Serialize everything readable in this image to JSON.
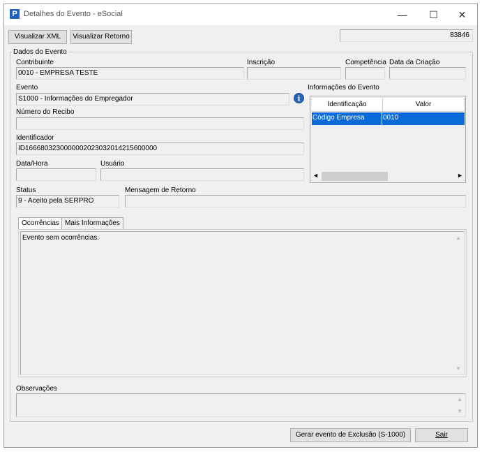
{
  "window": {
    "title": "Detalhes do Evento - eSocial",
    "app_icon": "P",
    "minimize": "—",
    "maximize": "☐",
    "close": "✕"
  },
  "toolbar": {
    "view_xml": "Visualizar XML",
    "view_return": "Visualizar Retorno",
    "id_value": "83846"
  },
  "group": {
    "title": "Dados do Evento",
    "contribuinte_label": "Contribuinte",
    "contribuinte_value": "0010 - EMPRESA TESTE",
    "inscricao_label": "Inscrição",
    "inscricao_value": "",
    "competencia_label": "Competência",
    "competencia_value": "",
    "data_criacao_label": "Data da Criação",
    "data_criacao_value": "",
    "evento_label": "Evento",
    "evento_value": "S1000 - Informações do Empregador",
    "info_icon": "i",
    "numero_recibo_label": "Número do Recibo",
    "numero_recibo_value": "",
    "identificador_label": "Identificador",
    "identificador_value": "ID1666803230000002023032014215600000",
    "data_hora_label": "Data/Hora",
    "data_hora_value": "",
    "usuario_label": "Usuário",
    "usuario_value": "",
    "status_label": "Status",
    "status_value": "9 - Aceito pela SERPRO",
    "mensagem_label": "Mensagem de Retorno",
    "mensagem_value": ""
  },
  "info_grid": {
    "title": "Informações do Evento",
    "columns": [
      "Identificação",
      "Valor"
    ],
    "rows": [
      [
        "Código Empresa",
        "0010"
      ]
    ],
    "scroll_left": "◄",
    "scroll_right": "►"
  },
  "tabs": [
    "Ocorrências",
    "Mais Informações"
  ],
  "ocorrencias_text": "Evento sem ocorrências.",
  "observacoes_label": "Observações",
  "observacoes_value": "",
  "footer": {
    "gerar_exclusao": "Gerar evento de Exclusão (S-1000)",
    "sair": "Sair"
  }
}
